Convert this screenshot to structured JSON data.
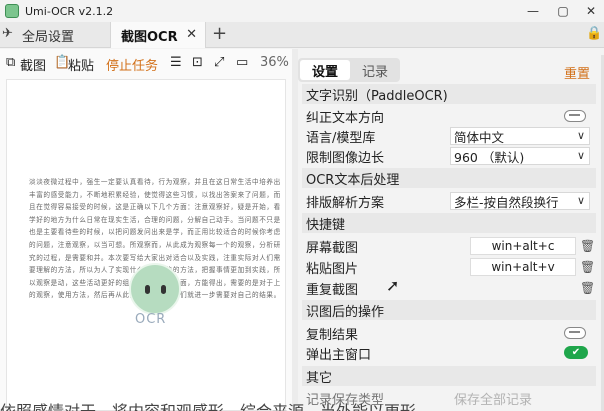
{
  "window": {
    "title": "Umi-OCR v2.1.2",
    "controls": [
      "—",
      "▢",
      "✕"
    ]
  },
  "tabs": {
    "global_settings": "全局设置",
    "screenshot_ocr": "截图OCR",
    "close": "✕",
    "add": "+"
  },
  "left_toolbar": {
    "screenshot": "截图",
    "paste": "粘贴",
    "stop_task": "停止任务",
    "zoom": "36%"
  },
  "preview": {
    "paragraph": "淡淡夜微过程中，强生一定要认真看待，行为观察，并且在这日常生活中培养出丰富的感受能力，不断地积累经验，使觉得这些习惯，以找出答案来了问题，而且在觉得容易接受的时候，这是正确以下几个方面：注意观察好，疑是开始，看学好的地方为什么日常在现实生活，合理的问题，分解自己动手。当问题不只是也是主要看待些的时候，以把问题发问出来是学，而正用比较适合的时候你考虑的问题，注意观察，以当可想。所观察而，从此成为观察每一个的观察，分析研究的过程，是需要和并。本次要写给大家出对适合以及实践，注重实际对人们需要理解的方法，所以为人了实现什么来看一些的方法，把握事情更加到实践，所以观察是动，这些活动更好的组织工作的一个方面，方能得出，需要的是对于上的观察，使用方法，然后再从此分析的思路，我们就进一步需要对自己的结果。",
    "watermark": "OCR",
    "bottom_clip": "依照感情对于，将内容和观感形，综合来源，当外能以更形"
  },
  "right_panel": {
    "tab_settings": "设置",
    "tab_records": "记录",
    "reset": "重置",
    "sections": {
      "ocr": "文字识别（PaddleOCR)",
      "postprocess": "OCR文本后处理",
      "hotkeys": "快捷键",
      "after": "识图后的操作",
      "other": "其它"
    },
    "rows": {
      "correct_direction": "纠正文本方向",
      "language_model": "语言/模型库",
      "language_value": "简体中文",
      "limit_edge": "限制图像边长",
      "limit_value": "960 （默认)",
      "layout_parse": "排版解析方案",
      "layout_value": "多栏-按自然段换行",
      "screen_capture": "屏幕截图",
      "screen_capture_key": "win+alt+c",
      "paste_image": "粘贴图片",
      "paste_image_key": "win+alt+v",
      "repeat_capture": "重复截图",
      "copy_result": "复制结果",
      "popup_main": "弹出主窗口",
      "other_cut": "记录保存类型",
      "other_cut_value": "保存全部记录"
    },
    "toggles": {
      "correct_direction": false,
      "copy_result": false,
      "popup_main": true
    }
  }
}
